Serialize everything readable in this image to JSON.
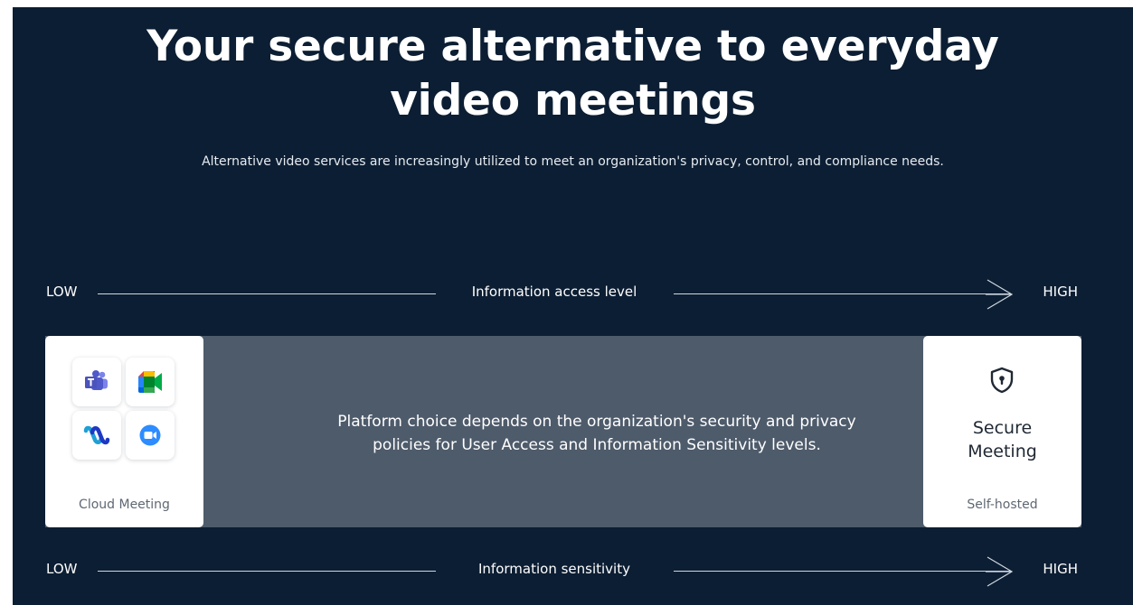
{
  "hero": {
    "title_line1": "Your secure alternative to everyday",
    "title_line2": "video meetings",
    "subtitle": "Alternative video services are increasingly utilized to meet an organization's privacy, control, and compliance needs."
  },
  "access_axis": {
    "low": "LOW",
    "label": "Information access level",
    "high": "HIGH"
  },
  "sensitivity_axis": {
    "low": "LOW",
    "label": "Information sensitivity",
    "high": "HIGH"
  },
  "spectrum": {
    "left_card": {
      "caption": "Cloud Meeting",
      "app_icons": [
        "microsoft-teams-icon",
        "google-meet-icon",
        "webex-icon",
        "zoom-icon"
      ]
    },
    "center_text_line1": "Platform choice depends on the organization's security and privacy",
    "center_text_line2": "policies for User Access and Information Sensitivity levels.",
    "right_card": {
      "icon": "shield-lock-icon",
      "label_line1": "Secure",
      "label_line2": "Meeting",
      "caption": "Self-hosted"
    }
  },
  "colors": {
    "background": "#0c1e33",
    "band": "#4e5b6b",
    "card": "#ffffff",
    "teams": "#5059c9",
    "zoom": "#2d8cff"
  }
}
